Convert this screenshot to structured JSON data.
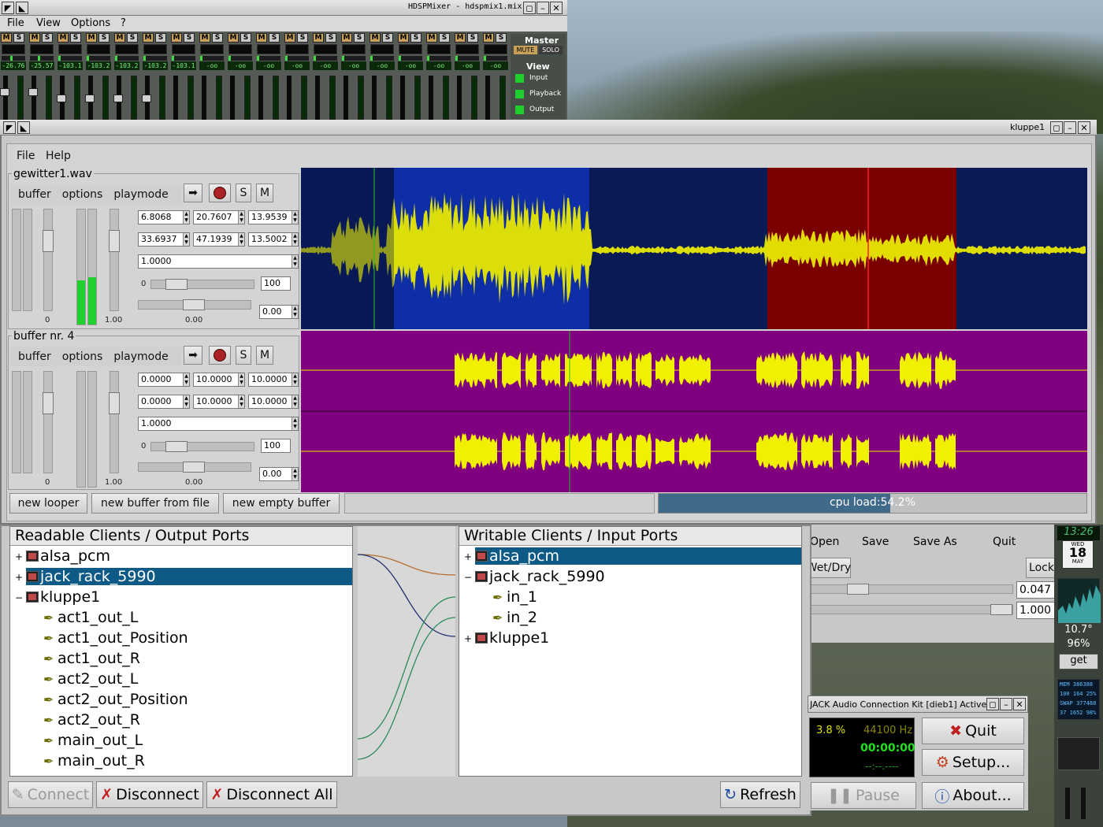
{
  "hdspmixer": {
    "title": "HDSPMixer - hdspmix1.mix",
    "menu": [
      "File",
      "View",
      "Options",
      "?"
    ],
    "mute_label": "M",
    "solo_label": "S",
    "channel_values": [
      "-26.76",
      "-25.57",
      "-103.1",
      "-103.2",
      "-103.2",
      "-103.2",
      "-103.1",
      "-oo",
      "-oo",
      "-oo",
      "-oo",
      "-oo",
      "-oo",
      "-oo",
      "-oo",
      "-oo",
      "-oo",
      "-oo"
    ],
    "master": {
      "label": "Master",
      "mute": "MUTE",
      "solo": "SOLO",
      "view_label": "View",
      "view_items": [
        "Input",
        "Playback",
        "Output"
      ]
    }
  },
  "kluppe": {
    "title": "kluppe1",
    "menu": [
      "File",
      "Help"
    ],
    "tracks": [
      {
        "name": "gewitter1.wav",
        "tabs": [
          "buffer",
          "options",
          "playmode"
        ],
        "solo": "S",
        "mute": "M",
        "row1": [
          "6.8068",
          "20.7607",
          "13.9539"
        ],
        "row2": [
          "33.6937",
          "47.1939",
          "13.5002"
        ],
        "speed": "1.0000",
        "range_min": "0",
        "range_max": "100",
        "pan_value": "0.00",
        "vol_min": "0",
        "vol_max": "1.00",
        "pan_label": "0.00"
      },
      {
        "name": "buffer nr. 4",
        "tabs": [
          "buffer",
          "options",
          "playmode"
        ],
        "solo": "S",
        "mute": "M",
        "row1": [
          "0.0000",
          "10.0000",
          "10.0000"
        ],
        "row2": [
          "0.0000",
          "10.0000",
          "10.0000"
        ],
        "speed": "1.0000",
        "range_min": "0",
        "range_max": "100",
        "pan_value": "0.00",
        "vol_min": "0",
        "vol_max": "1.00",
        "pan_label": "0.00"
      }
    ],
    "buttons": [
      "new looper",
      "new buffer from file",
      "new empty buffer"
    ],
    "cpu_load": "cpu load:54.2%",
    "cpu_fraction": 0.542
  },
  "qjackctl_connect": {
    "left_header": "Readable Clients / Output Ports",
    "right_header": "Writable Clients / Input Ports",
    "left_items": [
      {
        "label": "alsa_pcm",
        "level": 0,
        "type": "client",
        "expander": "+",
        "selected": false
      },
      {
        "label": "jack_rack_5990",
        "level": 0,
        "type": "client",
        "expander": "+",
        "selected": true
      },
      {
        "label": "kluppe1",
        "level": 0,
        "type": "client",
        "expander": "−",
        "selected": false
      },
      {
        "label": "act1_out_L",
        "level": 1,
        "type": "port",
        "selected": false
      },
      {
        "label": "act1_out_Position",
        "level": 1,
        "type": "port",
        "selected": false
      },
      {
        "label": "act1_out_R",
        "level": 1,
        "type": "port",
        "selected": false
      },
      {
        "label": "act2_out_L",
        "level": 1,
        "type": "port",
        "selected": false
      },
      {
        "label": "act2_out_Position",
        "level": 1,
        "type": "port",
        "selected": false
      },
      {
        "label": "act2_out_R",
        "level": 1,
        "type": "port",
        "selected": false
      },
      {
        "label": "main_out_L",
        "level": 1,
        "type": "port",
        "selected": false
      },
      {
        "label": "main_out_R",
        "level": 1,
        "type": "port",
        "selected": false
      }
    ],
    "right_items": [
      {
        "label": "alsa_pcm",
        "level": 0,
        "type": "client",
        "expander": "+",
        "selected": true
      },
      {
        "label": "jack_rack_5990",
        "level": 0,
        "type": "client",
        "expander": "−",
        "selected": false
      },
      {
        "label": "in_1",
        "level": 1,
        "type": "port",
        "selected": false
      },
      {
        "label": "in_2",
        "level": 1,
        "type": "port",
        "selected": false
      },
      {
        "label": "kluppe1",
        "level": 0,
        "type": "client",
        "expander": "+",
        "selected": false
      }
    ],
    "buttons": {
      "connect": "Connect",
      "disconnect": "Disconnect",
      "disconnect_all": "Disconnect All",
      "refresh": "Refresh"
    }
  },
  "jack_rack": {
    "toolbar": [
      "Open",
      "Save",
      "Save As",
      "Quit"
    ],
    "wet_dry": "Wet/Dry",
    "lock": "Lock",
    "value1": "0.047",
    "value2": "1.000"
  },
  "qjackctl_main": {
    "title": "JACK Audio Connection Kit [dieb1] Active.",
    "cpu": "3.8 %",
    "rate": "44100 Hz",
    "time": "00:00:00",
    "time2": "--:--.----",
    "buttons": {
      "quit": "Quit",
      "setup": "Setup...",
      "pause": "Pause",
      "about": "About..."
    }
  },
  "dock": {
    "clock": "13:26",
    "day": "WED",
    "date": "18",
    "month": "MAY",
    "temp": "10.7°",
    "humidity": "96%",
    "get": "get",
    "mem_lines": [
      "MEM 386388",
      "100 164 25%",
      "SWAP 377488",
      "37 1652 98%"
    ]
  }
}
